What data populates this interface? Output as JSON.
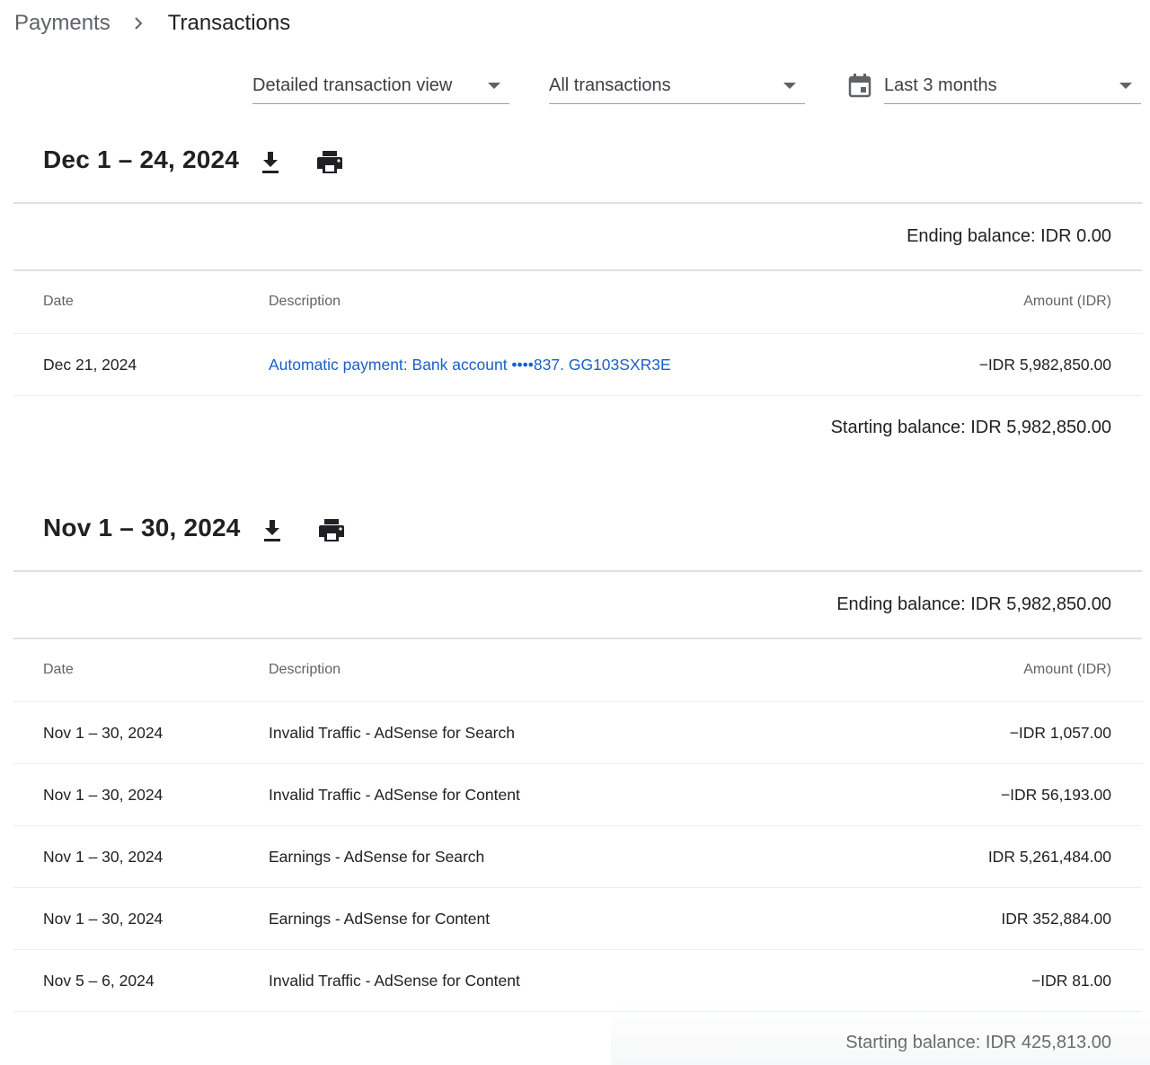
{
  "breadcrumb": {
    "parent": "Payments",
    "separator_icon": "chevron-right-icon",
    "current": "Transactions"
  },
  "filters": {
    "view": "Detailed transaction view",
    "type": "All transactions",
    "range_icon": "calendar-icon",
    "range": "Last 3 months"
  },
  "columns": {
    "date": "Date",
    "description": "Description",
    "amount": "Amount (IDR)"
  },
  "sections": [
    {
      "title": "Dec 1 – 24, 2024",
      "ending_balance": "Ending balance: IDR 0.00",
      "rows": [
        {
          "date": "Dec 21, 2024",
          "description": "Automatic payment: Bank account  ••••837. GG103SXR3E",
          "amount": "−IDR 5,982,850.00"
        }
      ],
      "starting_balance": "Starting balance: IDR 5,982,850.00"
    },
    {
      "title": "Nov 1 – 30, 2024",
      "ending_balance": "Ending balance: IDR 5,982,850.00",
      "rows": [
        {
          "date": "Nov 1 – 30, 2024",
          "description": "Invalid Traffic - AdSense for Search",
          "amount": "−IDR 1,057.00"
        },
        {
          "date": "Nov 1 – 30, 2024",
          "description": "Invalid Traffic - AdSense for Content",
          "amount": "−IDR 56,193.00"
        },
        {
          "date": "Nov 1 – 30, 2024",
          "description": "Earnings - AdSense for Search",
          "amount": "IDR 5,261,484.00"
        },
        {
          "date": "Nov 1 – 30, 2024",
          "description": "Earnings - AdSense for Content",
          "amount": "IDR 352,884.00"
        },
        {
          "date": "Nov 5 – 6, 2024",
          "description": "Invalid Traffic - AdSense for Content",
          "amount": "−IDR 81.00"
        }
      ],
      "starting_balance": "Starting balance: IDR 425,813.00"
    }
  ],
  "colors": {
    "link": "#1a5fc7",
    "text": "#202124",
    "muted": "#5f6368",
    "divider": "#e0e0e0"
  }
}
